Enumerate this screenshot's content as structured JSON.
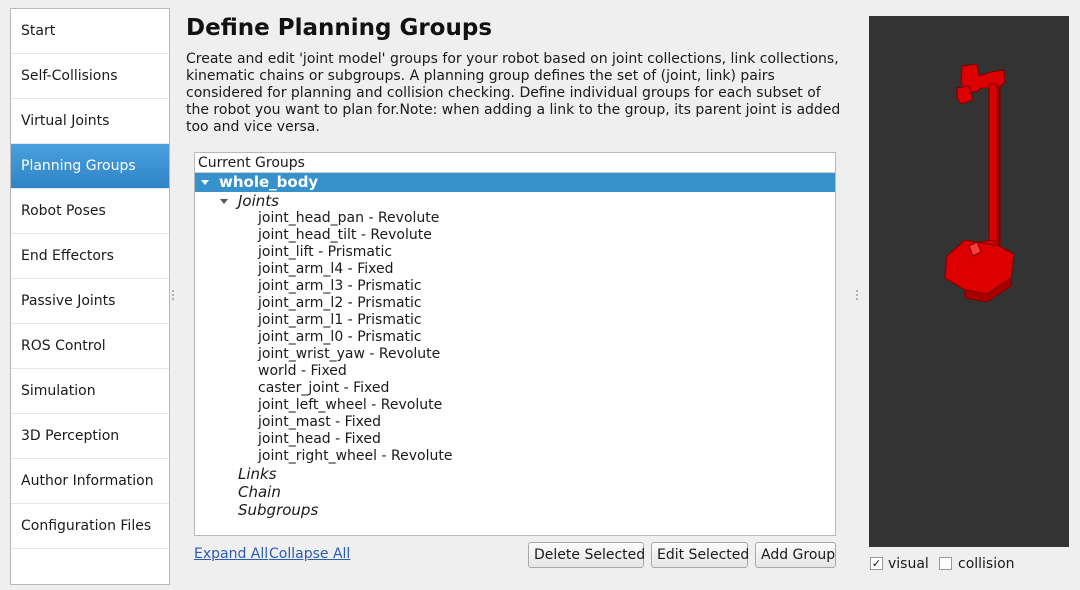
{
  "sidebar": {
    "items": [
      {
        "label": "Start"
      },
      {
        "label": "Self-Collisions"
      },
      {
        "label": "Virtual Joints"
      },
      {
        "label": "Planning Groups",
        "active": true
      },
      {
        "label": "Robot Poses"
      },
      {
        "label": "End Effectors"
      },
      {
        "label": "Passive Joints"
      },
      {
        "label": "ROS Control"
      },
      {
        "label": "Simulation"
      },
      {
        "label": "3D Perception"
      },
      {
        "label": "Author Information"
      },
      {
        "label": "Configuration Files"
      }
    ]
  },
  "main": {
    "title": "Define Planning Groups",
    "description": "Create and edit 'joint model' groups for your robot based on joint collections, link collections, kinematic chains or subgroups. A planning group defines the set of (joint, link) pairs considered for planning and collision checking. Define individual groups for each subset of the robot you want to plan for.Note: when adding a link to the group, its parent joint is added too and vice versa."
  },
  "tree": {
    "header": "Current Groups",
    "group_name": "whole_body",
    "joints_label": "Joints",
    "joints": [
      {
        "name": "joint_head_pan",
        "type": "Revolute"
      },
      {
        "name": "joint_head_tilt",
        "type": "Revolute"
      },
      {
        "name": "joint_lift",
        "type": "Prismatic"
      },
      {
        "name": "joint_arm_l4",
        "type": "Fixed"
      },
      {
        "name": "joint_arm_l3",
        "type": "Prismatic"
      },
      {
        "name": "joint_arm_l2",
        "type": "Prismatic"
      },
      {
        "name": "joint_arm_l1",
        "type": "Prismatic"
      },
      {
        "name": "joint_arm_l0",
        "type": "Prismatic"
      },
      {
        "name": "joint_wrist_yaw",
        "type": "Revolute"
      },
      {
        "name": "world",
        "type": "Fixed"
      },
      {
        "name": "caster_joint",
        "type": "Fixed"
      },
      {
        "name": "joint_left_wheel",
        "type": "Revolute"
      },
      {
        "name": "joint_mast",
        "type": "Fixed"
      },
      {
        "name": "joint_head",
        "type": "Fixed"
      },
      {
        "name": "joint_right_wheel",
        "type": "Revolute"
      }
    ],
    "separator": " - ",
    "links_label": "Links",
    "chain_label": "Chain",
    "subgroups_label": "Subgroups"
  },
  "actions": {
    "expand_all": "Expand All",
    "collapse_all": "Collapse All",
    "delete_selected": "Delete Selected",
    "edit_selected": "Edit Selected",
    "add_group": "Add Group"
  },
  "viewer": {
    "visual_label": "visual",
    "visual_checked": true,
    "collision_label": "collision",
    "collision_checked": false,
    "background_color": "#333333",
    "robot_color": "#dd0000"
  },
  "colors": {
    "accent": "#3792cc",
    "link": "#2a5db0"
  }
}
